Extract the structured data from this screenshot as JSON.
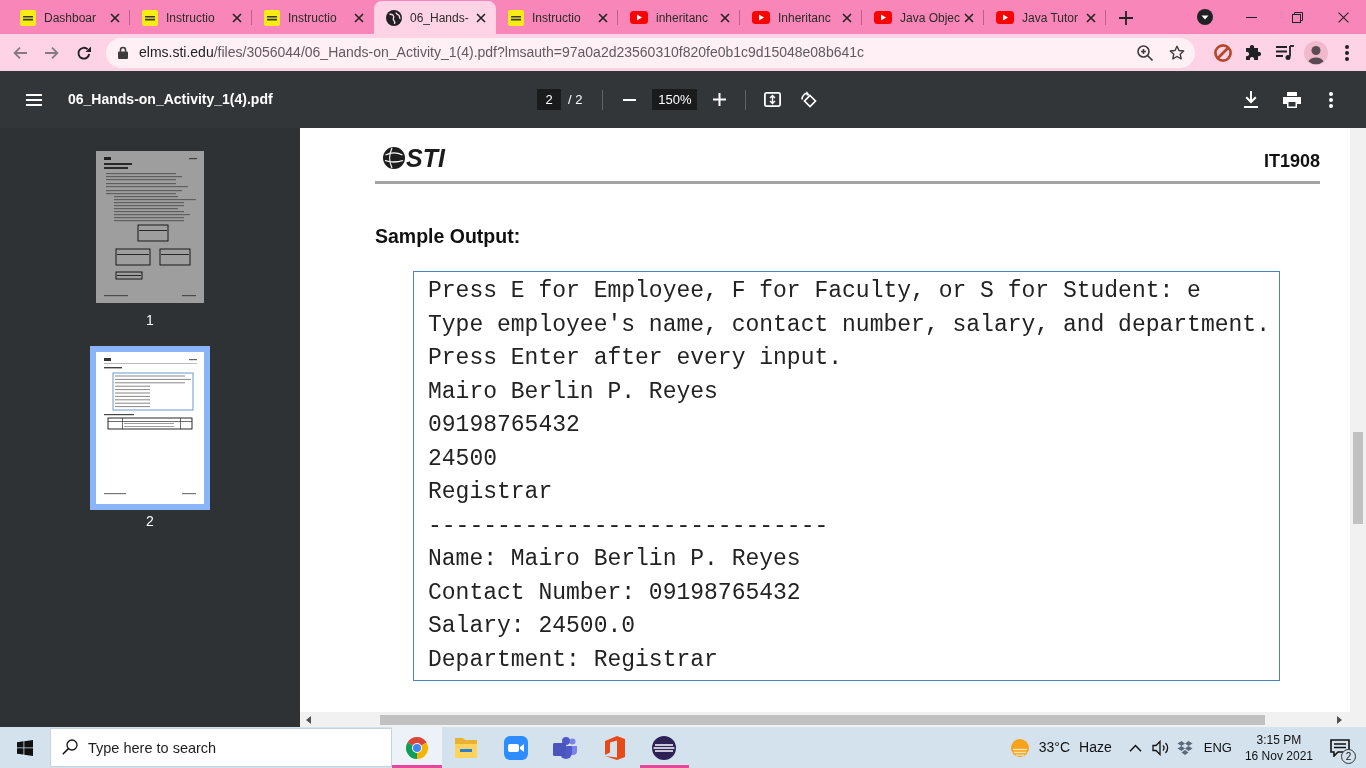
{
  "browser": {
    "tabs": [
      {
        "kind": "sti",
        "title": "Dashboar",
        "selected": false
      },
      {
        "kind": "sti",
        "title": "Instructio",
        "selected": false
      },
      {
        "kind": "sti",
        "title": "Instructio",
        "selected": false
      },
      {
        "kind": "page",
        "title": "06_Hands-",
        "selected": true
      },
      {
        "kind": "sti",
        "title": "Instructio",
        "selected": false
      },
      {
        "kind": "video",
        "title": "inheritanc",
        "selected": false
      },
      {
        "kind": "video",
        "title": "Inheritanc",
        "selected": false
      },
      {
        "kind": "video",
        "title": "Java Objec",
        "selected": false
      },
      {
        "kind": "video",
        "title": "Java Tutor",
        "selected": false
      }
    ],
    "address": {
      "host": "elms.sti.edu",
      "path": "/files/3056044/06_Hands-on_Activity_1(4).pdf?lmsauth=97a0a2d23560310f820fe0b1c9d15048e08b641c"
    }
  },
  "pdf_viewer": {
    "title": "06_Hands-on_Activity_1(4).pdf",
    "page": "2",
    "page_count": "/ 2",
    "zoom": "150%"
  },
  "thumbnails": [
    {
      "label": "1",
      "selected": false
    },
    {
      "label": "2",
      "selected": true
    }
  ],
  "document": {
    "logo": "STI",
    "course_code": "IT1908",
    "heading": "Sample Output:",
    "output_lines": [
      "Press E for Employee, F for Faculty, or S for Student: e",
      "Type employee's name, contact number, salary, and department.",
      "Press Enter after every input.",
      "Mairo Berlin P. Reyes",
      "09198765432",
      "24500",
      "Registrar",
      "-----------------------------",
      "Name: Mairo Berlin P. Reyes",
      "Contact Number: 09198765432",
      "Salary: 24500.0",
      "Department: Registrar"
    ]
  },
  "taskbar": {
    "search": {
      "placeholder": "Type here to search"
    },
    "apps": [
      {
        "kind": "browser",
        "focused": true,
        "running": true
      },
      {
        "kind": "folder",
        "focused": false,
        "running": false
      },
      {
        "kind": "camera",
        "focused": false,
        "running": false
      },
      {
        "kind": "people",
        "focused": false,
        "running": false
      },
      {
        "kind": "office",
        "focused": false,
        "running": false
      },
      {
        "kind": "sphere",
        "focused": false,
        "running": true
      }
    ],
    "weather": {
      "temperature": "33°C",
      "condition": "Haze"
    },
    "language": "ENG",
    "time": "3:15 PM",
    "date": "16 Nov 2021",
    "notifications": "2"
  }
}
